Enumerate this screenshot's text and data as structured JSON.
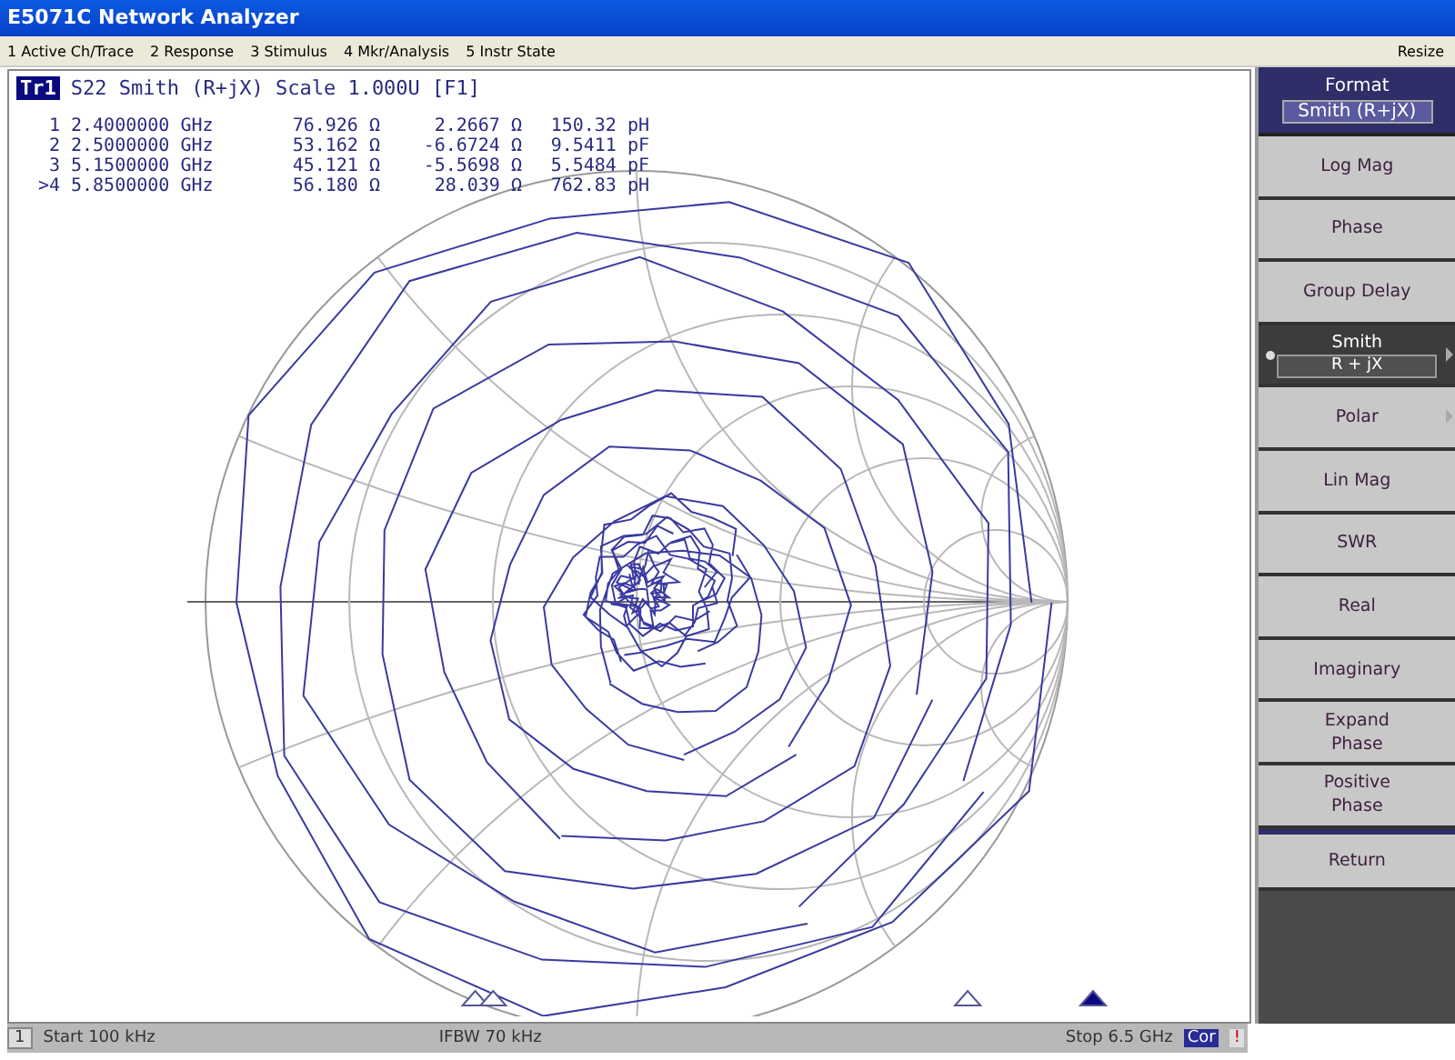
{
  "window": {
    "title": "E5071C Network Analyzer"
  },
  "menu": [
    "1 Active Ch/Trace",
    "2 Response",
    "3 Stimulus",
    "4 Mkr/Analysis",
    "5 Instr State"
  ],
  "menu_right": "Resize",
  "trace_header": {
    "trace": "Tr1",
    "text": "S22 Smith (R+jX) Scale 1.000U [F1]"
  },
  "markers": [
    {
      "id": "1",
      "freq": "2.4000000 GHz",
      "r": "76.926 Ω",
      "x": "2.2667 Ω",
      "value": "150.32 pH",
      "selected": false
    },
    {
      "id": "2",
      "freq": "2.5000000 GHz",
      "r": "53.162 Ω",
      "x": "-6.6724 Ω",
      "value": "9.5411 pF",
      "selected": false
    },
    {
      "id": "3",
      "freq": "5.1500000 GHz",
      "r": "45.121 Ω",
      "x": "-5.5698 Ω",
      "value": "5.5484 pF",
      "selected": false
    },
    {
      "id": ">4",
      "freq": "5.8500000 GHz",
      "r": "56.180 Ω",
      "x": "28.039 Ω",
      "value": "762.83 pH",
      "selected": true
    }
  ],
  "softkey_header": {
    "title": "Format",
    "value": "Smith (R+jX)"
  },
  "softkeys": [
    {
      "kind": "plain",
      "lines": [
        "Log Mag"
      ],
      "selected": false
    },
    {
      "kind": "plain",
      "lines": [
        "Phase"
      ],
      "selected": false
    },
    {
      "kind": "plain",
      "lines": [
        "Group Delay"
      ],
      "selected": false
    },
    {
      "kind": "submenu",
      "lines": [
        "Smith"
      ],
      "value": "R + jX",
      "selected": true
    },
    {
      "kind": "submenu",
      "lines": [
        "Polar"
      ],
      "selected": false
    },
    {
      "kind": "plain",
      "lines": [
        "Lin Mag"
      ],
      "selected": false
    },
    {
      "kind": "plain",
      "lines": [
        "SWR"
      ],
      "selected": false
    },
    {
      "kind": "plain",
      "lines": [
        "Real"
      ],
      "selected": false
    },
    {
      "kind": "plain",
      "lines": [
        "Imaginary"
      ],
      "selected": false
    },
    {
      "kind": "plain",
      "lines": [
        "Expand",
        "Phase"
      ],
      "selected": false
    },
    {
      "kind": "plain",
      "lines": [
        "Positive",
        "Phase"
      ],
      "selected": false
    },
    {
      "kind": "return",
      "lines": [
        "Return"
      ],
      "selected": false
    }
  ],
  "status_bar": {
    "channel": "1",
    "start": "Start 100 kHz",
    "ifbw": "IFBW 70 kHz",
    "stop": "Stop 6.5 GHz",
    "correction": "Cor",
    "warning": "!"
  }
}
